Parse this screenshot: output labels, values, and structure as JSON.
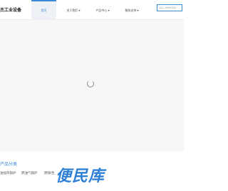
{
  "header": {
    "logo_text": "杰工业设备",
    "nav": [
      {
        "label": "首页",
        "active": true
      },
      {
        "label": "关于我们 ▾",
        "active": false
      },
      {
        "label": "产品中心 ▾",
        "active": false
      },
      {
        "label": "服务支持 ▾",
        "active": false
      }
    ],
    "search_placeholder": "请输入你想搜索的"
  },
  "banner": {
    "loading_icon": "spinner-icon"
  },
  "categories": {
    "title": "产品分类",
    "items": [
      "油加热锅炉",
      "燃油气锅炉",
      "燃煤/生"
    ]
  },
  "watermark": {
    "text": "便民库"
  },
  "colors": {
    "accent": "#3b8ad8",
    "watermark": "#2d7fd6",
    "banner_bg": "#f7f7f7"
  }
}
